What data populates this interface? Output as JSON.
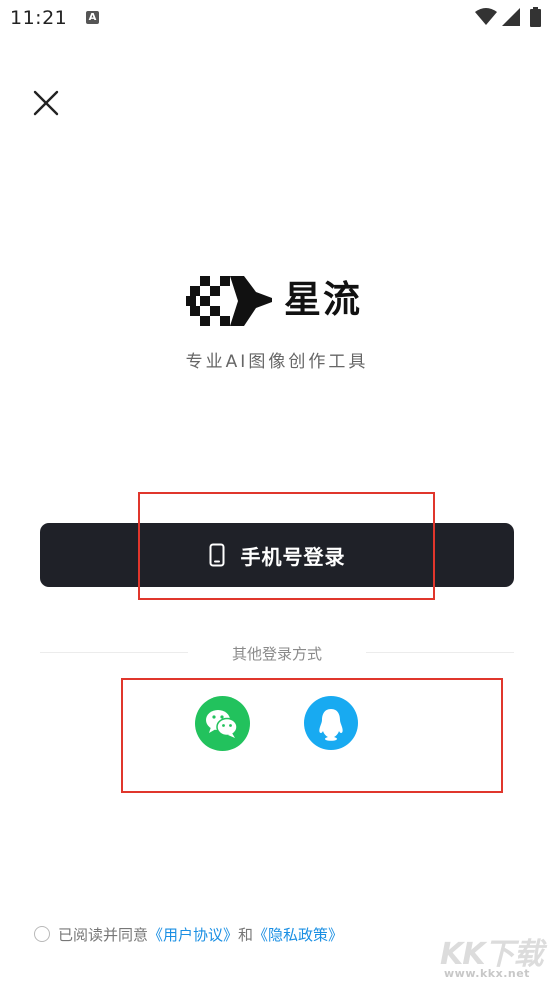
{
  "status_bar": {
    "time": "11:21",
    "notification_icon": "A",
    "icons": [
      "wifi-icon",
      "signal-icon",
      "battery-icon"
    ]
  },
  "header": {
    "close_icon": "close-icon"
  },
  "brand": {
    "name": "星流",
    "tagline": "专业AI图像创作工具"
  },
  "login": {
    "phone_button_label": "手机号登录",
    "other_methods_label": "其他登录方式",
    "other_methods": [
      {
        "name": "WeChat",
        "icon": "wechat-icon",
        "color": "#22c25d"
      },
      {
        "name": "QQ",
        "icon": "qq-icon",
        "color": "#18aaf1"
      }
    ]
  },
  "agreement": {
    "prefix": "已阅读并同意",
    "user_agreement": "《用户协议》",
    "conjunction": "和",
    "privacy_policy": "《隐私政策》"
  },
  "watermark": {
    "text": "KK下载",
    "url": "www.kkx.net"
  },
  "colors": {
    "button_dark": "#1f2128",
    "highlight": "#e0362c",
    "link": "#1a8fe3",
    "wechat": "#22c25d",
    "qq": "#18aaf1"
  }
}
